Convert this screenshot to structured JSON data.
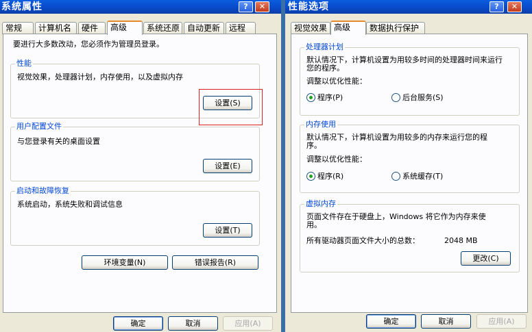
{
  "sysprops": {
    "title": "系统属性",
    "help_label": "?",
    "close_label": "✕",
    "tabs": [
      "常规",
      "计算机名",
      "硬件",
      "高级",
      "系统还原",
      "自动更新",
      "远程"
    ],
    "intro": "要进行大多数改动，您必须作为管理员登录。",
    "performance": {
      "label": "性能",
      "desc": "视觉效果，处理器计划，内存使用，以及虚拟内存",
      "button": "设置(S)"
    },
    "profiles": {
      "label": "用户配置文件",
      "desc": "与您登录有关的桌面设置",
      "button": "设置(E)"
    },
    "startup": {
      "label": "启动和故障恢复",
      "desc": "系统启动，系统失败和调试信息",
      "button": "设置(T)"
    },
    "env_button": "环境变量(N)",
    "error_button": "错误报告(R)",
    "ok": "确定",
    "cancel": "取消",
    "apply": "应用(A)"
  },
  "perfopts": {
    "title": "性能选项",
    "help_label": "?",
    "close_label": "✕",
    "tabs": [
      "视觉效果",
      "高级",
      "数据执行保护"
    ],
    "cpu": {
      "label": "处理器计划",
      "desc1": "默认情况下，计算机设置为用较多时间的处理器时间来运行",
      "desc2": "您的程序。",
      "adjust": "调整以优化性能：",
      "opt1": "程序(P)",
      "opt2": "后台服务(S)",
      "selected": "opt1"
    },
    "memory": {
      "label": "内存使用",
      "desc1": "默认情况下，计算机设置为用较多的内存来运行您的程",
      "desc2": "序。",
      "adjust": "调整以优化性能：",
      "opt1": "程序(R)",
      "opt2": "系统缓存(T)",
      "selected": "opt1"
    },
    "vm": {
      "label": "虚拟内存",
      "desc1": "页面文件存在于硬盘上，Windows 将它作为内存来使",
      "desc2": "用。",
      "total_label": "所有驱动器页面文件大小的总数：",
      "total_value": "2048 MB",
      "button": "更改(C)"
    },
    "ok": "确定",
    "cancel": "取消",
    "apply": "应用(A)"
  },
  "colors": {
    "title_blue": "#0a5ee0",
    "group_label": "#0046d5",
    "highlight_red": "#e02020",
    "tab_orange": "#e68b2c"
  }
}
